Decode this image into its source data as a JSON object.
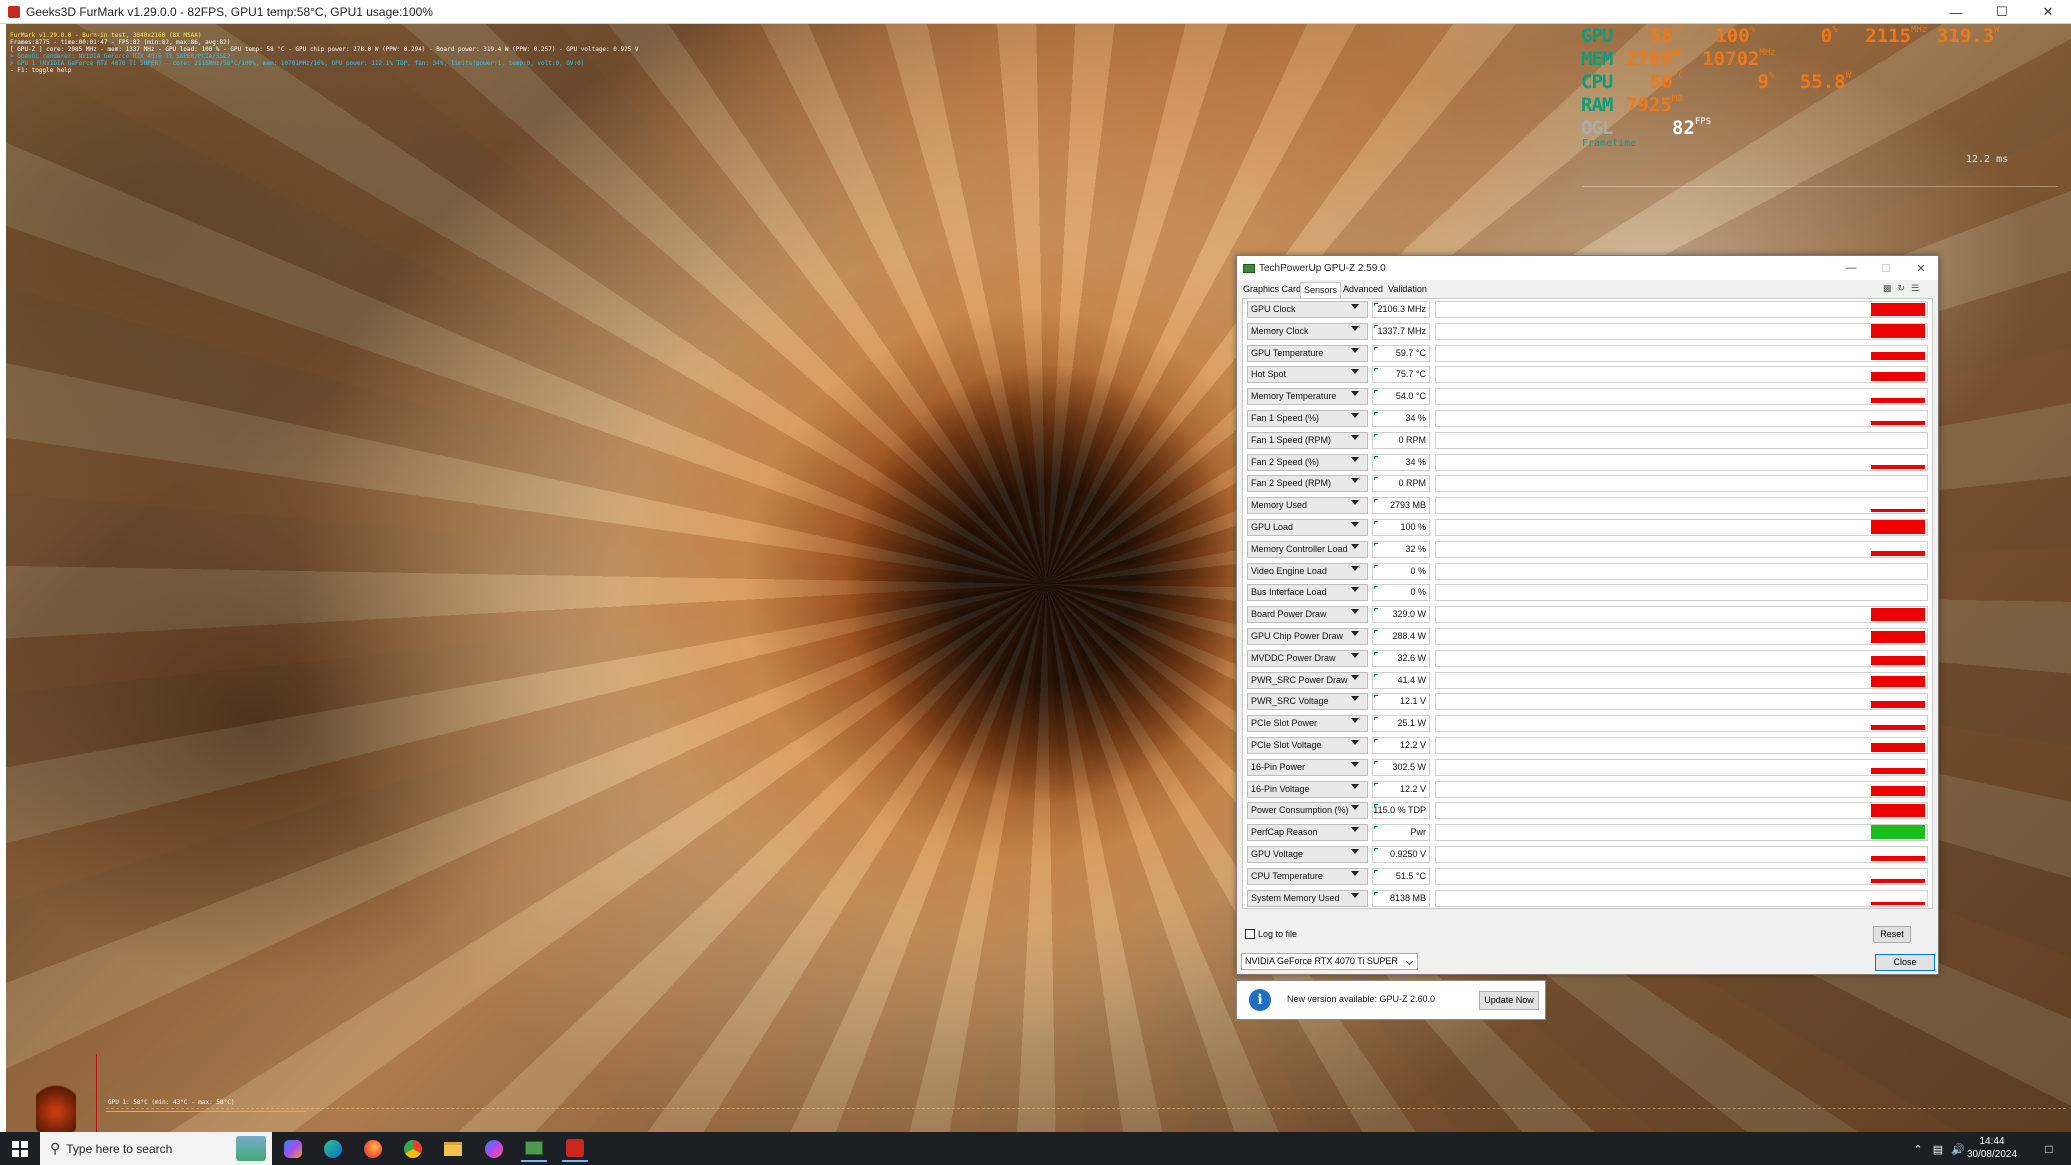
{
  "window_title": "Geeks3D FurMark v1.29.0.0 - 82FPS, GPU1 temp:58°C, GPU1 usage:100%",
  "furmark_info": {
    "line1": "FurMark v1.29.0.0 - Burn-in test, 3840x2160 (8X MSAA)",
    "line2": "Frames:8775 - time:00:01:47 - FPS:82 (min:82, max:86, avg:82)",
    "line3": "[ GPU-Z ] core: 2085 MHz - mem: 1337 MHz - GPU load: 100 % - GPU temp: 58 °C - GPU chip power: 278.0 W (PPW: 0.294) - Board power: 319.4 W (PPW: 0.257) - GPU voltage: 0.925 V",
    "line4": "> OpenGL renderer: NVIDIA GeForce RTX 4070 Ti SUPER/PCIe/SSE2",
    "line5": "> GPU 1 (NVIDIA GeForce RTX 4070 Ti SUPER) - core: 2115MHz/58°C/100%, mem: 10701MHz/16%, GPU power: 112.1% TDP, fan: 34%, limits(power:1, temp:0, volt:0, OV:0)",
    "line6": "- F1: toggle help"
  },
  "osd": {
    "gpu": {
      "label": "GPU",
      "temp": "58",
      "temp_unit": "°C",
      "usage": "100",
      "usage_unit": "%",
      "extra": "0",
      "extra_unit": "%",
      "clock": "2115",
      "clock_unit": "MHz",
      "power": "319.3",
      "power_unit": "W"
    },
    "mem": {
      "label": "MEM",
      "used": "2769",
      "used_unit": "MB",
      "clock": "10702",
      "clock_unit": "MHz"
    },
    "cpu": {
      "label": "CPU",
      "temp": "50",
      "temp_unit": "°C",
      "usage": "9",
      "usage_unit": "%",
      "power": "55.8",
      "power_unit": "W"
    },
    "ram": {
      "label": "RAM",
      "used": "7925",
      "used_unit": "MB"
    },
    "ogl": {
      "label": "OGL",
      "fps": "82",
      "fps_unit": "FPS"
    },
    "frametime_label": "Frametime",
    "frametime_value": "12.2 ms"
  },
  "gpu_temp_graph_label": "GPU 1: 58°C (min: 43°C - max: 58°C)",
  "gpuz": {
    "title": "TechPowerUp GPU-Z 2.59.0",
    "tabs": [
      "Graphics Card",
      "Sensors",
      "Advanced",
      "Validation"
    ],
    "active_tab": "Sensors",
    "sensors": [
      {
        "name": "GPU Clock",
        "value": "2106.3 MHz",
        "level": 0.88
      },
      {
        "name": "Memory Clock",
        "value": "1337.7 MHz",
        "level": 0.9
      },
      {
        "name": "GPU Temperature",
        "value": "59.7 °C",
        "level": 0.55
      },
      {
        "name": "Hot Spot",
        "value": "75.7 °C",
        "level": 0.6
      },
      {
        "name": "Memory Temperature",
        "value": "54.0 °C",
        "level": 0.3
      },
      {
        "name": "Fan 1 Speed (%)",
        "value": "34 %",
        "level": 0.25
      },
      {
        "name": "Fan 1 Speed (RPM)",
        "value": "0 RPM",
        "level": 0
      },
      {
        "name": "Fan 2 Speed (%)",
        "value": "34 %",
        "level": 0.25
      },
      {
        "name": "Fan 2 Speed (RPM)",
        "value": "0 RPM",
        "level": 0
      },
      {
        "name": "Memory Used",
        "value": "2793 MB",
        "level": 0.17
      },
      {
        "name": "GPU Load",
        "value": "100 %",
        "level": 1.0
      },
      {
        "name": "Memory Controller Load",
        "value": "32 %",
        "level": 0.3
      },
      {
        "name": "Video Engine Load",
        "value": "0 %",
        "level": 0
      },
      {
        "name": "Bus Interface Load",
        "value": "0 %",
        "level": 0
      },
      {
        "name": "Board Power Draw",
        "value": "329.0 W",
        "level": 0.85
      },
      {
        "name": "GPU Chip Power Draw",
        "value": "288.4 W",
        "level": 0.8
      },
      {
        "name": "MVDDC Power Draw",
        "value": "32.6 W",
        "level": 0.6
      },
      {
        "name": "PWR_SRC Power Draw",
        "value": "41.4 W",
        "level": 0.75
      },
      {
        "name": "PWR_SRC Voltage",
        "value": "12.1 V",
        "level": 0.45
      },
      {
        "name": "PCIe Slot Power",
        "value": "25.1 W",
        "level": 0.3
      },
      {
        "name": "PCIe Slot Voltage",
        "value": "12.2 V",
        "level": 0.6
      },
      {
        "name": "16-Pin Power",
        "value": "302.5 W",
        "level": 0.4
      },
      {
        "name": "16-Pin Voltage",
        "value": "12.2 V",
        "level": 0.65
      },
      {
        "name": "Power Consumption (%)",
        "value": "115.0 % TDP",
        "level": 0.85
      },
      {
        "name": "PerfCap Reason",
        "value": "Pwr",
        "level": 1.0,
        "color": "#1bbf1b"
      },
      {
        "name": "GPU Voltage",
        "value": "0.9250 V",
        "level": 0.3
      },
      {
        "name": "CPU Temperature",
        "value": "51.5 °C",
        "level": 0.25
      },
      {
        "name": "System Memory Used",
        "value": "8138 MB",
        "level": 0.2
      }
    ],
    "log_to_file": "Log to file",
    "reset": "Reset",
    "gpu_select": "NVIDIA GeForce RTX 4070 Ti SUPER",
    "close": "Close"
  },
  "update_notice": {
    "message": "New version available: GPU-Z 2.60.0",
    "button": "Update Now"
  },
  "taskbar": {
    "search_placeholder": "Type here to search",
    "time": "14:44",
    "date": "30/08/2024"
  }
}
